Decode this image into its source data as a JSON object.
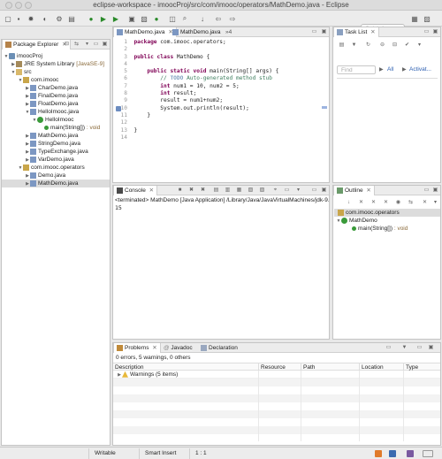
{
  "window": {
    "title": "eclipse-workspace - imoocProj/src/com/imooc/operators/MathDemo.java - Eclipse",
    "quick_access_placeholder": "Quick Access"
  },
  "package_explorer": {
    "tab_label": "Package Explorer",
    "items": [
      {
        "label": "imoocProj"
      },
      {
        "label": "JRE System Library",
        "suffix": "[JavaSE-9]"
      },
      {
        "label": "src"
      },
      {
        "label": "com.imooc"
      },
      {
        "label": "CharDemo.java"
      },
      {
        "label": "FinalDemo.java"
      },
      {
        "label": "FloatDemo.java"
      },
      {
        "label": "HelloImooc.java"
      },
      {
        "label": "HelloImooc"
      },
      {
        "label": "main(String[])",
        "suffix": ": void"
      },
      {
        "label": "MathDemo.java"
      },
      {
        "label": "StringDemo.java"
      },
      {
        "label": "TypeExchange.java"
      },
      {
        "label": "VarDemo.java"
      },
      {
        "label": "com.imooc.operators"
      },
      {
        "label": "Demo.java"
      },
      {
        "label": "MathDemo.java"
      }
    ]
  },
  "editor": {
    "tabs": [
      {
        "label": "MathDemo.java"
      },
      {
        "label": "MathDemo.java"
      },
      {
        "label": "»4"
      }
    ],
    "line_numbers": [
      "1",
      "2",
      "3",
      "4",
      "5",
      "6",
      "7",
      "8",
      "9",
      "10",
      "11",
      "12",
      "13",
      "14"
    ],
    "code": {
      "l1_kw": "package",
      "l1_rest": " com.imooc.operators;",
      "l3_kw1": "public",
      "l3_kw2": "class",
      "l3_rest": " MathDemo {",
      "l5_kw1": "public",
      "l5_kw2": "static",
      "l5_kw3": "void",
      "l5_rest": " main(String[] args) {",
      "l6_pre": "// ",
      "l6_todo": "TODO",
      "l6_rest": " Auto-generated method stub",
      "l7_kw": "int",
      "l7_rest": " num1 = 10, num2 = 5;",
      "l8_kw": "int",
      "l8_rest": " result;",
      "l9": "result = num1+num2;",
      "l10": "System.out.println(result);",
      "l11": "}",
      "l13": "}"
    }
  },
  "task_list": {
    "tab_label": "Task List",
    "find_placeholder": "Find",
    "all_label": "All",
    "activate_label": "Activat..."
  },
  "console": {
    "tab_label": "Console",
    "terminated": "<terminated> MathDemo [Java Application] /Library/Java/JavaVirtualMachines/jdk-9.",
    "output": "15"
  },
  "outline": {
    "tab_label": "Outline",
    "items": [
      {
        "label": "com.imooc.operators"
      },
      {
        "label": "MathDemo"
      },
      {
        "label": "main(String[])",
        "suffix": ": void"
      }
    ]
  },
  "problems": {
    "tabs": [
      {
        "label": "Problems"
      },
      {
        "label": "Javadoc"
      },
      {
        "label": "Declaration"
      }
    ],
    "summary": "0 errors, 5 warnings, 0 others",
    "columns": [
      "Description",
      "Resource",
      "Path",
      "Location",
      "Type"
    ],
    "rows": [
      {
        "description": "Warnings (5 items)"
      }
    ]
  },
  "statusbar": {
    "writable": "Writable",
    "insert_mode": "Smart Insert",
    "position": "1 : 1"
  },
  "colors": {
    "keyword": "#7f0055",
    "comment": "#3f7f5f",
    "selection": "#dcdcdc"
  }
}
